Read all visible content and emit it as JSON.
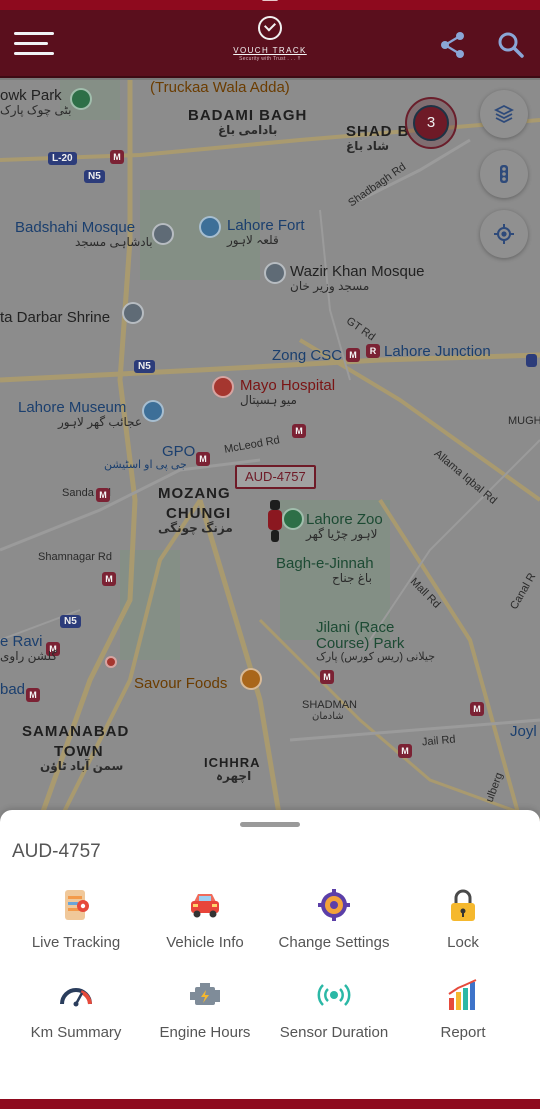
{
  "colors": {
    "app_bar": "#5a0f1d",
    "status_strip": "#8e0a1e",
    "accent": "#6e1a27",
    "sheet_bg": "#ffffff",
    "label_text": "#555555"
  },
  "header": {
    "brand_name": "VOUCH TRACK",
    "brand_tagline": "Security with Trust . . . !!",
    "menu_icon": "hamburger-icon",
    "share_icon": "share-icon",
    "search_icon": "search-icon"
  },
  "map": {
    "cluster_count": "3",
    "controls": [
      "layers-icon",
      "traffic-icon",
      "my-location-icon"
    ],
    "vehicle_label": "AUD-4757",
    "places": {
      "truckaa": "(Truckaa Wala Adda)",
      "park": "owk Park",
      "park_ur": "بٹی چوک پارک",
      "badami": "BADAMI BAGH",
      "badami_ur": "بادامی باغ",
      "shad": "SHAD B",
      "shad_ur": "شاد باغ",
      "badshahi": "Badshahi Mosque",
      "badshahi_ur": "بادشاہی مسجد",
      "lahore_fort": "Lahore Fort",
      "lahore_fort_ur": "قلعہ لاہور",
      "wazir": "Wazir Khan Mosque",
      "wazir_ur": "مسجد وزیر خان",
      "darbar": "ta Darbar Shrine",
      "zong": "Zong CSC",
      "lahore_junction": "Lahore Junction",
      "mayo": "Mayo Hospital",
      "mayo_ur": "میو ہسپتال",
      "museum": "Lahore Museum",
      "museum_ur": "عجائب گھر لاہور",
      "gpo": "GPO",
      "gpo_ur": "جی پی او اسٹیشن",
      "mcleod": "McLeod Rd",
      "sanda": "Sanda Rd",
      "mozang": "MOZANG",
      "chungi": "CHUNGI",
      "mozang_ur": "مزنگ چونگی",
      "zoo": "Lahore Zoo",
      "zoo_ur": "لاہور چڑیا گھر",
      "bagh": "Bagh-e-Jinnah",
      "bagh_ur": "باغ جناح",
      "shamnagar": "Shamnagar Rd",
      "ravi": "e Ravi",
      "ravi_ur": "گلشن راوی",
      "jilani1": "Jilani (Race",
      "jilani2": "Course) Park",
      "jilani_ur": "جیلانی (ریس کورس) پارک",
      "savour": "Savour Foods",
      "bad": "bad",
      "samanabad": "SAMANABAD",
      "town": "TOWN",
      "samanabad_ur": "سمن آباد ٹاؤن",
      "shadman": "SHADMAN",
      "shadman_ur": "شادمان",
      "ichhra": "ICHHRA",
      "ichhra_ur": "اچھرہ",
      "jail": "Jail Rd",
      "joy": "Joyl",
      "allama": "Allama Iqbal Rd",
      "mall": "Mall Rd",
      "canal": "Canal R",
      "gt": "GT Rd",
      "shadbagh_rd": "Shadbagh Rd",
      "mugh": "MUGH",
      "ulberg": "ulberg",
      "n5": "N5",
      "l20": "L-20"
    }
  },
  "sheet": {
    "title": "AUD-4757",
    "actions": [
      {
        "label": "Live Tracking",
        "icon": "live-tracking-icon"
      },
      {
        "label": "Vehicle Info",
        "icon": "car-icon"
      },
      {
        "label": "Change Settings",
        "icon": "settings-gear-icon"
      },
      {
        "label": "Lock",
        "icon": "lock-icon"
      },
      {
        "label": "Km Summary",
        "icon": "speedometer-icon"
      },
      {
        "label": "Engine Hours",
        "icon": "engine-icon"
      },
      {
        "label": "Sensor Duration",
        "icon": "sensor-icon"
      },
      {
        "label": "Report",
        "icon": "report-chart-icon"
      }
    ]
  }
}
